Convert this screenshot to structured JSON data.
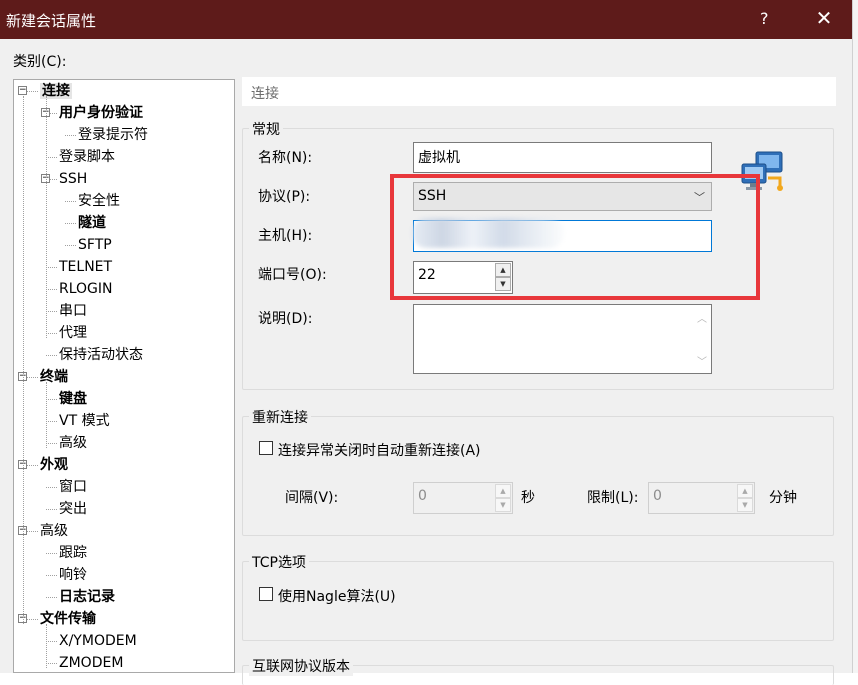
{
  "window": {
    "title": "新建会话属性",
    "help_glyph": "?",
    "close_glyph": "✕"
  },
  "category_label": "类别(C):",
  "tree": [
    {
      "label": "连接",
      "bold": true,
      "selected": true,
      "level": 0,
      "expander": "minus"
    },
    {
      "label": "用户身份验证",
      "bold": true,
      "level": 1,
      "expander": "minus"
    },
    {
      "label": "登录提示符",
      "level": 2
    },
    {
      "label": "登录脚本",
      "level": 1
    },
    {
      "label": "SSH",
      "level": 1,
      "expander": "minus"
    },
    {
      "label": "安全性",
      "level": 2
    },
    {
      "label": "隧道",
      "bold": true,
      "level": 2
    },
    {
      "label": "SFTP",
      "level": 2
    },
    {
      "label": "TELNET",
      "level": 1
    },
    {
      "label": "RLOGIN",
      "level": 1
    },
    {
      "label": "串口",
      "level": 1
    },
    {
      "label": "代理",
      "level": 1
    },
    {
      "label": "保持活动状态",
      "level": 1
    },
    {
      "label": "终端",
      "bold": true,
      "level": 0,
      "expander": "minus"
    },
    {
      "label": "键盘",
      "bold": true,
      "level": 1
    },
    {
      "label": "VT 模式",
      "level": 1
    },
    {
      "label": "高级",
      "level": 1
    },
    {
      "label": "外观",
      "bold": true,
      "level": 0,
      "expander": "minus"
    },
    {
      "label": "窗口",
      "level": 1
    },
    {
      "label": "突出",
      "level": 1
    },
    {
      "label": "高级",
      "level": 0,
      "expander": "minus"
    },
    {
      "label": "跟踪",
      "level": 1
    },
    {
      "label": "响铃",
      "level": 1
    },
    {
      "label": "日志记录",
      "bold": true,
      "level": 1
    },
    {
      "label": "文件传输",
      "bold": true,
      "level": 0,
      "expander": "minus"
    },
    {
      "label": "X/YMODEM",
      "level": 1
    },
    {
      "label": "ZMODEM",
      "level": 1
    }
  ],
  "panel": {
    "header": "连接",
    "general": {
      "title": "常规",
      "name_label": "名称(N):",
      "name_value": "虚拟机",
      "protocol_label": "协议(P):",
      "protocol_value": "SSH",
      "protocol_arrow": "﹀",
      "host_label": "主机(H):",
      "host_value": "",
      "port_label": "端口号(O):",
      "port_value": "22",
      "desc_label": "说明(D):",
      "desc_value": ""
    },
    "reconnect": {
      "title": "重新连接",
      "checkbox_label": "连接异常关闭时自动重新连接(A)",
      "checked": false,
      "interval_label": "间隔(V):",
      "interval_value": "0",
      "interval_unit": "秒",
      "limit_label": "限制(L):",
      "limit_value": "0",
      "limit_unit": "分钟"
    },
    "tcp": {
      "title": "TCP选项",
      "checkbox_label": "使用Nagle算法(U)",
      "checked": false
    },
    "ipver": {
      "title": "互联网协议版本"
    }
  },
  "colors": {
    "titlebar": "#5e1b1a",
    "highlight_box": "#e8373b",
    "dialog_bg": "#f0f0f0"
  },
  "icons": {
    "connection": "network-computers-icon",
    "spin_up": "▲",
    "spin_down": "▼",
    "scroll_up": "︿",
    "scroll_down": "﹀"
  }
}
